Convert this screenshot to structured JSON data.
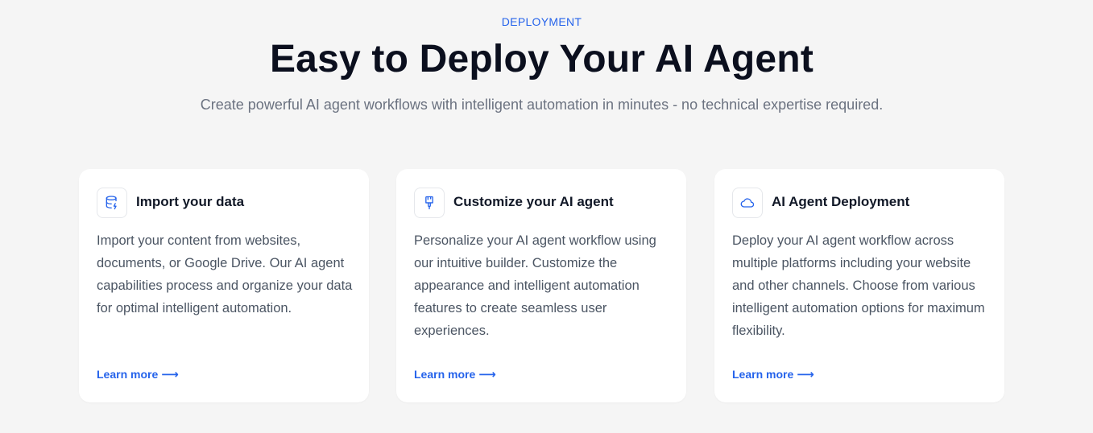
{
  "section": {
    "eyebrow": "DEPLOYMENT",
    "title": "Easy to Deploy Your AI Agent",
    "subtitle": "Create powerful AI agent workflows with intelligent automation in minutes - no technical expertise required."
  },
  "cards": [
    {
      "icon": "database-icon",
      "title": "Import your data",
      "description": "Import your content from websites, documents, or Google Drive. Our AI agent capabilities process and organize your data for optimal intelligent automation.",
      "link_label": "Learn more",
      "link_arrow": "⟶"
    },
    {
      "icon": "paintbrush-icon",
      "title": "Customize your AI agent",
      "description": "Personalize your AI agent workflow using our intuitive builder. Customize the appearance and intelligent automation features to create seamless user experiences.",
      "link_label": "Learn more",
      "link_arrow": "⟶"
    },
    {
      "icon": "cloud-icon",
      "title": "AI Agent Deployment",
      "description": "Deploy your AI agent workflow across multiple platforms including your website and other channels. Choose from various intelligent automation options for maximum flexibility.",
      "link_label": "Learn more",
      "link_arrow": "⟶"
    }
  ],
  "colors": {
    "accent": "#2563eb",
    "background": "#f5f5f5",
    "card": "#ffffff",
    "heading": "#0b0f1e",
    "body_text": "#4b5563"
  }
}
